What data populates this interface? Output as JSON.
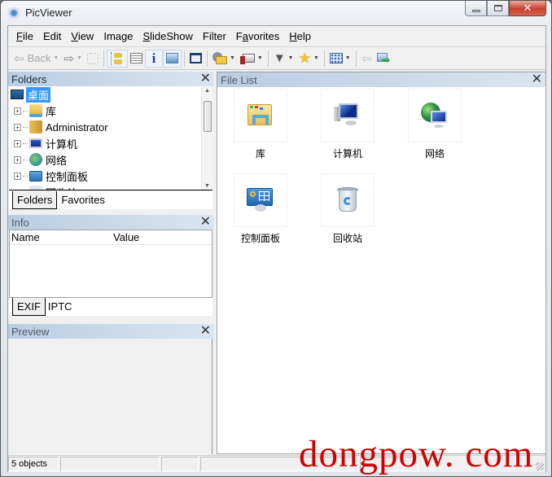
{
  "window": {
    "title": "PicViewer",
    "controls": {
      "minimize": "—",
      "maximize": "▢",
      "close": "✕"
    }
  },
  "menu": [
    {
      "label": "File",
      "accel": "F",
      "rest": "ile"
    },
    {
      "label": "Edit",
      "accel": "",
      "rest": "Edit"
    },
    {
      "label": "View",
      "accel": "V",
      "rest": "iew"
    },
    {
      "label": "Image",
      "accel": "",
      "rest": "Image"
    },
    {
      "label": "SlideShow",
      "accel": "S",
      "rest": "lideShow"
    },
    {
      "label": "Filter",
      "accel": "",
      "rest": "Filter"
    },
    {
      "label": "Favorites",
      "accel_pre": "F",
      "accel": "a",
      "rest": "vorites"
    },
    {
      "label": "Help",
      "accel": "H",
      "rest": "elp"
    }
  ],
  "toolbar": {
    "back_label": "Back",
    "dropdown_glyph": "▼",
    "back_glyph": "⇦",
    "forward_glyph": "⇨"
  },
  "folders": {
    "title": "Folders",
    "close": "✕",
    "tree": [
      {
        "label": "桌面",
        "icon": "desktop-icon",
        "selected": true
      },
      {
        "label": "库",
        "icon": "library-icon"
      },
      {
        "label": "Administrator",
        "icon": "user-folder-icon"
      },
      {
        "label": "计算机",
        "icon": "computer-icon"
      },
      {
        "label": "网络",
        "icon": "network-icon"
      },
      {
        "label": "控制面板",
        "icon": "control-panel-icon"
      },
      {
        "label": "回收站",
        "icon": "recycle-bin-icon"
      }
    ],
    "tabs": [
      "Folders",
      "Favorites"
    ],
    "active_tab": "Folders"
  },
  "info": {
    "title": "Info",
    "close": "✕",
    "columns": [
      "Name",
      "Value"
    ],
    "rows": [],
    "tabs": [
      "EXIF",
      "IPTC"
    ],
    "active_tab": "EXIF"
  },
  "preview": {
    "title": "Preview",
    "close": "✕"
  },
  "file_list": {
    "title": "File List",
    "close": "✕",
    "items": [
      {
        "label": "库",
        "icon": "library-icon"
      },
      {
        "label": "计算机",
        "icon": "computer-icon"
      },
      {
        "label": "网络",
        "icon": "network-icon"
      },
      {
        "label": "控制面板",
        "icon": "control-panel-icon"
      },
      {
        "label": "回收站",
        "icon": "recycle-bin-icon"
      }
    ]
  },
  "status": {
    "objects": "5 objects"
  },
  "watermark": "dongpow. com"
}
